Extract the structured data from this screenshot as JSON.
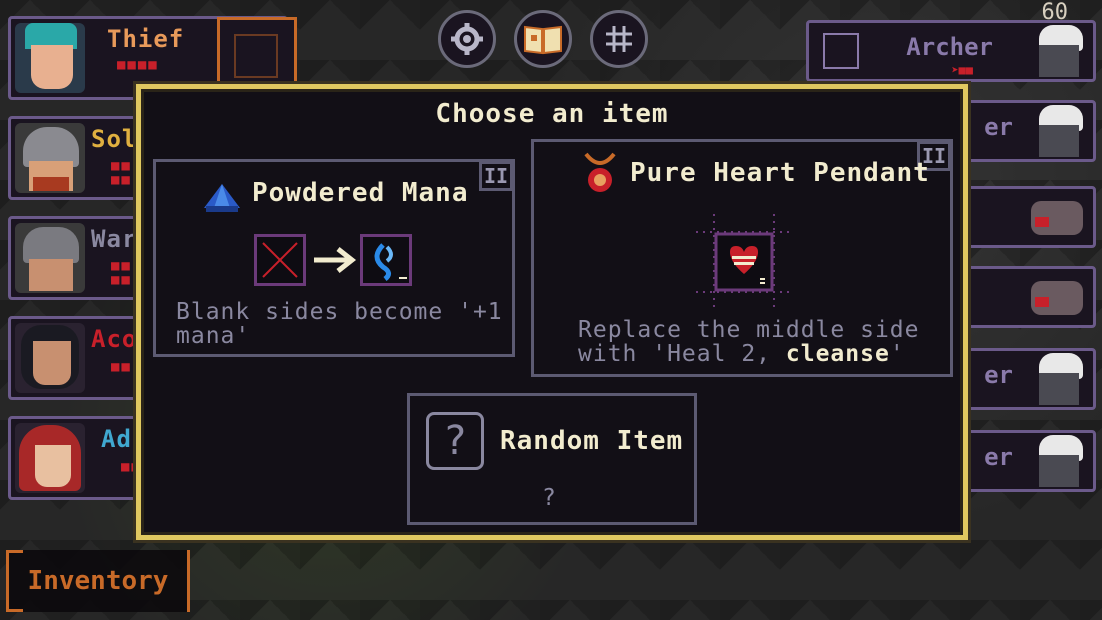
{
  "counter": "60",
  "heroes": [
    {
      "name": "Thief",
      "color": "#e89a5a",
      "pips": "■■■■",
      "portrait": "teal-hair-thief-portrait"
    },
    {
      "name": "Sol",
      "color": "#e0b040",
      "pips": "■■\n■■",
      "portrait": "helmet-soldier-portrait"
    },
    {
      "name": "War",
      "color": "#8a88a0",
      "pips": "■■\n■■",
      "portrait": "helmet-warrior-portrait"
    },
    {
      "name": "Aco",
      "color": "#c8202a",
      "pips": "■■",
      "portrait": "dark-hair-acolyte-portrait"
    },
    {
      "name": "Ad",
      "color": "#40a8d0",
      "pips": "■■",
      "portrait": "red-hood-adept-portrait"
    }
  ],
  "monsters": [
    {
      "name": "Archer",
      "pips": "➤■■"
    },
    {
      "name": "er"
    },
    {
      "name": ""
    },
    {
      "name": ""
    },
    {
      "name": "er"
    },
    {
      "name": "er"
    }
  ],
  "inventory_label": "Inventory",
  "modal": {
    "title": "Choose an item",
    "items": [
      {
        "tier": "II",
        "title": "Powdered Mana",
        "desc": "Blank sides become '+1 mana'",
        "icon": "mana-crystal-icon"
      },
      {
        "tier": "II",
        "title": "Pure Heart Pendant",
        "desc_pre": "Replace the middle side with 'Heal 2, ",
        "desc_hl": "cleanse",
        "desc_post": "'",
        "icon": "pendant-icon"
      },
      {
        "title": "Random Item",
        "desc": "?",
        "icon": "question-mark-icon"
      }
    ]
  }
}
